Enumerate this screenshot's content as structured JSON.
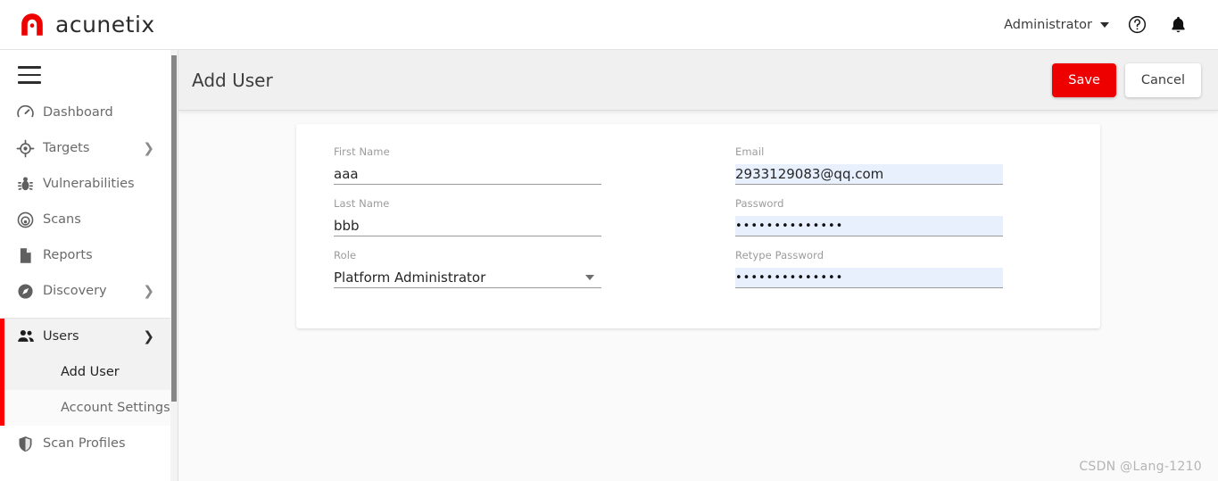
{
  "topbar": {
    "brand_name": "acunetix",
    "user_label": "Administrator",
    "help_icon": "help-circle-icon",
    "notifications_icon": "bell-icon"
  },
  "sidebar": {
    "menu_icon": "hamburger-icon",
    "items": [
      {
        "label": "Dashboard",
        "icon": "dashboard-gauge-icon",
        "expandable": false
      },
      {
        "label": "Targets",
        "icon": "target-crosshair-icon",
        "expandable": true
      },
      {
        "label": "Vulnerabilities",
        "icon": "bug-icon",
        "expandable": false
      },
      {
        "label": "Scans",
        "icon": "radar-icon",
        "expandable": false
      },
      {
        "label": "Reports",
        "icon": "document-icon",
        "expandable": false
      },
      {
        "label": "Discovery",
        "icon": "compass-icon",
        "expandable": true
      }
    ],
    "users_group": {
      "label": "Users",
      "icon": "people-icon",
      "expanded": true,
      "chevron": "chevron-down-icon",
      "children": [
        {
          "label": "Add User",
          "active": true
        },
        {
          "label": "Account Settings",
          "active": false
        }
      ]
    },
    "after_items": [
      {
        "label": "Scan Profiles",
        "icon": "shield-icon",
        "expandable": false
      }
    ],
    "accent_color": "#ff0000"
  },
  "page": {
    "title": "Add User",
    "save_label": "Save",
    "cancel_label": "Cancel",
    "save_color": "#ee0000"
  },
  "form": {
    "left": [
      {
        "label": "First Name",
        "value": "aaa",
        "type": "text",
        "autofill": false
      },
      {
        "label": "Last Name",
        "value": "bbb",
        "type": "text",
        "autofill": false
      },
      {
        "label": "Role",
        "value": "Platform Administrator",
        "type": "select",
        "autofill": false
      }
    ],
    "right": [
      {
        "label": "Email",
        "value": "2933129083@qq.com",
        "type": "email",
        "autofill": true
      },
      {
        "label": "Password",
        "value": "••••••••••••••",
        "type": "password",
        "autofill": true
      },
      {
        "label": "Retype Password",
        "value": "••••••••••••••",
        "type": "password",
        "autofill": true
      }
    ]
  },
  "watermark": {
    "text": "CSDN @Lang-1210"
  }
}
